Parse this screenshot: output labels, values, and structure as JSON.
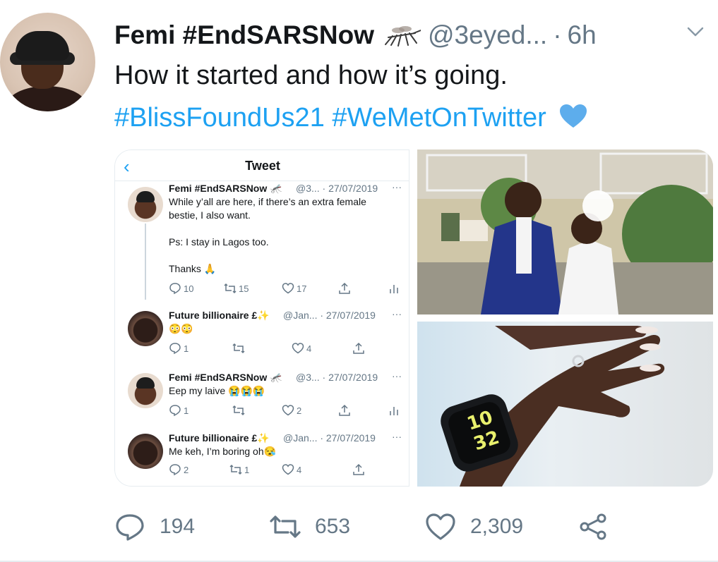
{
  "tweet": {
    "display_name": "Femi #EndSARSNow",
    "handle": "@3eyed...",
    "separator": "·",
    "time": "6h",
    "text_line1": "How it started and how it’s going.",
    "hashtags": "#BlissFoundUs21 #WeMetOnTwitter",
    "icons": {
      "name_emoji": "mosquito-icon",
      "hashtag_emoji": "blue-heart-icon",
      "menu": "chevron-down-icon"
    }
  },
  "embedded": {
    "header_title": "Tweet",
    "back_icon": "chevron-left-icon",
    "replies": [
      {
        "name": "Femi #EndSARSNow 🦟",
        "meta": "@3... · 27/07/2019",
        "text": "While y’all are here, if there’s an extra female\nbestie, I also want.\n\nPs: I stay in Lagos too.\n\nThanks 🙏",
        "replies": "10",
        "retweets": "15",
        "likes": "17",
        "show_analytics": true
      },
      {
        "name": "Future billionaire £✨",
        "meta": "@Jan... · 27/07/2019",
        "text": "😳😳",
        "replies": "1",
        "retweets": "",
        "likes": "4",
        "show_analytics": false
      },
      {
        "name": "Femi #EndSARSNow 🦟",
        "meta": "@3... · 27/07/2019",
        "text": "Eep my laive 😭😭😭",
        "replies": "1",
        "retweets": "",
        "likes": "2",
        "show_analytics": true
      },
      {
        "name": "Future billionaire £✨",
        "meta": "@Jan... · 27/07/2019",
        "text": "Me keh, I’m boring oh😪",
        "replies": "2",
        "retweets": "1",
        "likes": "4",
        "show_analytics": false
      }
    ],
    "more_label": "···"
  },
  "photos": {
    "top_alt": "couple photo",
    "watch_time_top": "10",
    "watch_time_bottom": "32"
  },
  "actions": {
    "replies": "194",
    "retweets": "653",
    "likes": "2,309"
  },
  "colors": {
    "accent": "#1da1f2",
    "text": "#14171a",
    "muted": "#657786"
  }
}
